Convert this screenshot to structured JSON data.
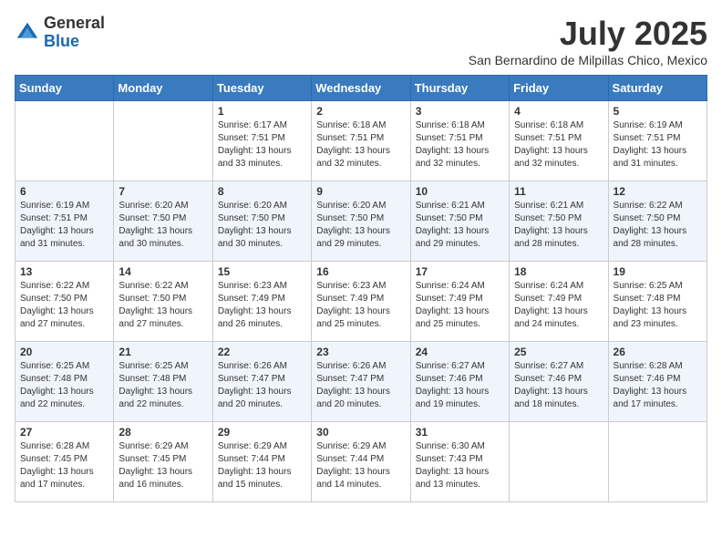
{
  "header": {
    "logo_general": "General",
    "logo_blue": "Blue",
    "month": "July 2025",
    "location": "San Bernardino de Milpillas Chico, Mexico"
  },
  "weekdays": [
    "Sunday",
    "Monday",
    "Tuesday",
    "Wednesday",
    "Thursday",
    "Friday",
    "Saturday"
  ],
  "weeks": [
    [
      {
        "day": "",
        "info": ""
      },
      {
        "day": "",
        "info": ""
      },
      {
        "day": "1",
        "info": "Sunrise: 6:17 AM\nSunset: 7:51 PM\nDaylight: 13 hours and 33 minutes."
      },
      {
        "day": "2",
        "info": "Sunrise: 6:18 AM\nSunset: 7:51 PM\nDaylight: 13 hours and 32 minutes."
      },
      {
        "day": "3",
        "info": "Sunrise: 6:18 AM\nSunset: 7:51 PM\nDaylight: 13 hours and 32 minutes."
      },
      {
        "day": "4",
        "info": "Sunrise: 6:18 AM\nSunset: 7:51 PM\nDaylight: 13 hours and 32 minutes."
      },
      {
        "day": "5",
        "info": "Sunrise: 6:19 AM\nSunset: 7:51 PM\nDaylight: 13 hours and 31 minutes."
      }
    ],
    [
      {
        "day": "6",
        "info": "Sunrise: 6:19 AM\nSunset: 7:51 PM\nDaylight: 13 hours and 31 minutes."
      },
      {
        "day": "7",
        "info": "Sunrise: 6:20 AM\nSunset: 7:50 PM\nDaylight: 13 hours and 30 minutes."
      },
      {
        "day": "8",
        "info": "Sunrise: 6:20 AM\nSunset: 7:50 PM\nDaylight: 13 hours and 30 minutes."
      },
      {
        "day": "9",
        "info": "Sunrise: 6:20 AM\nSunset: 7:50 PM\nDaylight: 13 hours and 29 minutes."
      },
      {
        "day": "10",
        "info": "Sunrise: 6:21 AM\nSunset: 7:50 PM\nDaylight: 13 hours and 29 minutes."
      },
      {
        "day": "11",
        "info": "Sunrise: 6:21 AM\nSunset: 7:50 PM\nDaylight: 13 hours and 28 minutes."
      },
      {
        "day": "12",
        "info": "Sunrise: 6:22 AM\nSunset: 7:50 PM\nDaylight: 13 hours and 28 minutes."
      }
    ],
    [
      {
        "day": "13",
        "info": "Sunrise: 6:22 AM\nSunset: 7:50 PM\nDaylight: 13 hours and 27 minutes."
      },
      {
        "day": "14",
        "info": "Sunrise: 6:22 AM\nSunset: 7:50 PM\nDaylight: 13 hours and 27 minutes."
      },
      {
        "day": "15",
        "info": "Sunrise: 6:23 AM\nSunset: 7:49 PM\nDaylight: 13 hours and 26 minutes."
      },
      {
        "day": "16",
        "info": "Sunrise: 6:23 AM\nSunset: 7:49 PM\nDaylight: 13 hours and 25 minutes."
      },
      {
        "day": "17",
        "info": "Sunrise: 6:24 AM\nSunset: 7:49 PM\nDaylight: 13 hours and 25 minutes."
      },
      {
        "day": "18",
        "info": "Sunrise: 6:24 AM\nSunset: 7:49 PM\nDaylight: 13 hours and 24 minutes."
      },
      {
        "day": "19",
        "info": "Sunrise: 6:25 AM\nSunset: 7:48 PM\nDaylight: 13 hours and 23 minutes."
      }
    ],
    [
      {
        "day": "20",
        "info": "Sunrise: 6:25 AM\nSunset: 7:48 PM\nDaylight: 13 hours and 22 minutes."
      },
      {
        "day": "21",
        "info": "Sunrise: 6:25 AM\nSunset: 7:48 PM\nDaylight: 13 hours and 22 minutes."
      },
      {
        "day": "22",
        "info": "Sunrise: 6:26 AM\nSunset: 7:47 PM\nDaylight: 13 hours and 20 minutes."
      },
      {
        "day": "23",
        "info": "Sunrise: 6:26 AM\nSunset: 7:47 PM\nDaylight: 13 hours and 20 minutes."
      },
      {
        "day": "24",
        "info": "Sunrise: 6:27 AM\nSunset: 7:46 PM\nDaylight: 13 hours and 19 minutes."
      },
      {
        "day": "25",
        "info": "Sunrise: 6:27 AM\nSunset: 7:46 PM\nDaylight: 13 hours and 18 minutes."
      },
      {
        "day": "26",
        "info": "Sunrise: 6:28 AM\nSunset: 7:46 PM\nDaylight: 13 hours and 17 minutes."
      }
    ],
    [
      {
        "day": "27",
        "info": "Sunrise: 6:28 AM\nSunset: 7:45 PM\nDaylight: 13 hours and 17 minutes."
      },
      {
        "day": "28",
        "info": "Sunrise: 6:29 AM\nSunset: 7:45 PM\nDaylight: 13 hours and 16 minutes."
      },
      {
        "day": "29",
        "info": "Sunrise: 6:29 AM\nSunset: 7:44 PM\nDaylight: 13 hours and 15 minutes."
      },
      {
        "day": "30",
        "info": "Sunrise: 6:29 AM\nSunset: 7:44 PM\nDaylight: 13 hours and 14 minutes."
      },
      {
        "day": "31",
        "info": "Sunrise: 6:30 AM\nSunset: 7:43 PM\nDaylight: 13 hours and 13 minutes."
      },
      {
        "day": "",
        "info": ""
      },
      {
        "day": "",
        "info": ""
      }
    ]
  ]
}
